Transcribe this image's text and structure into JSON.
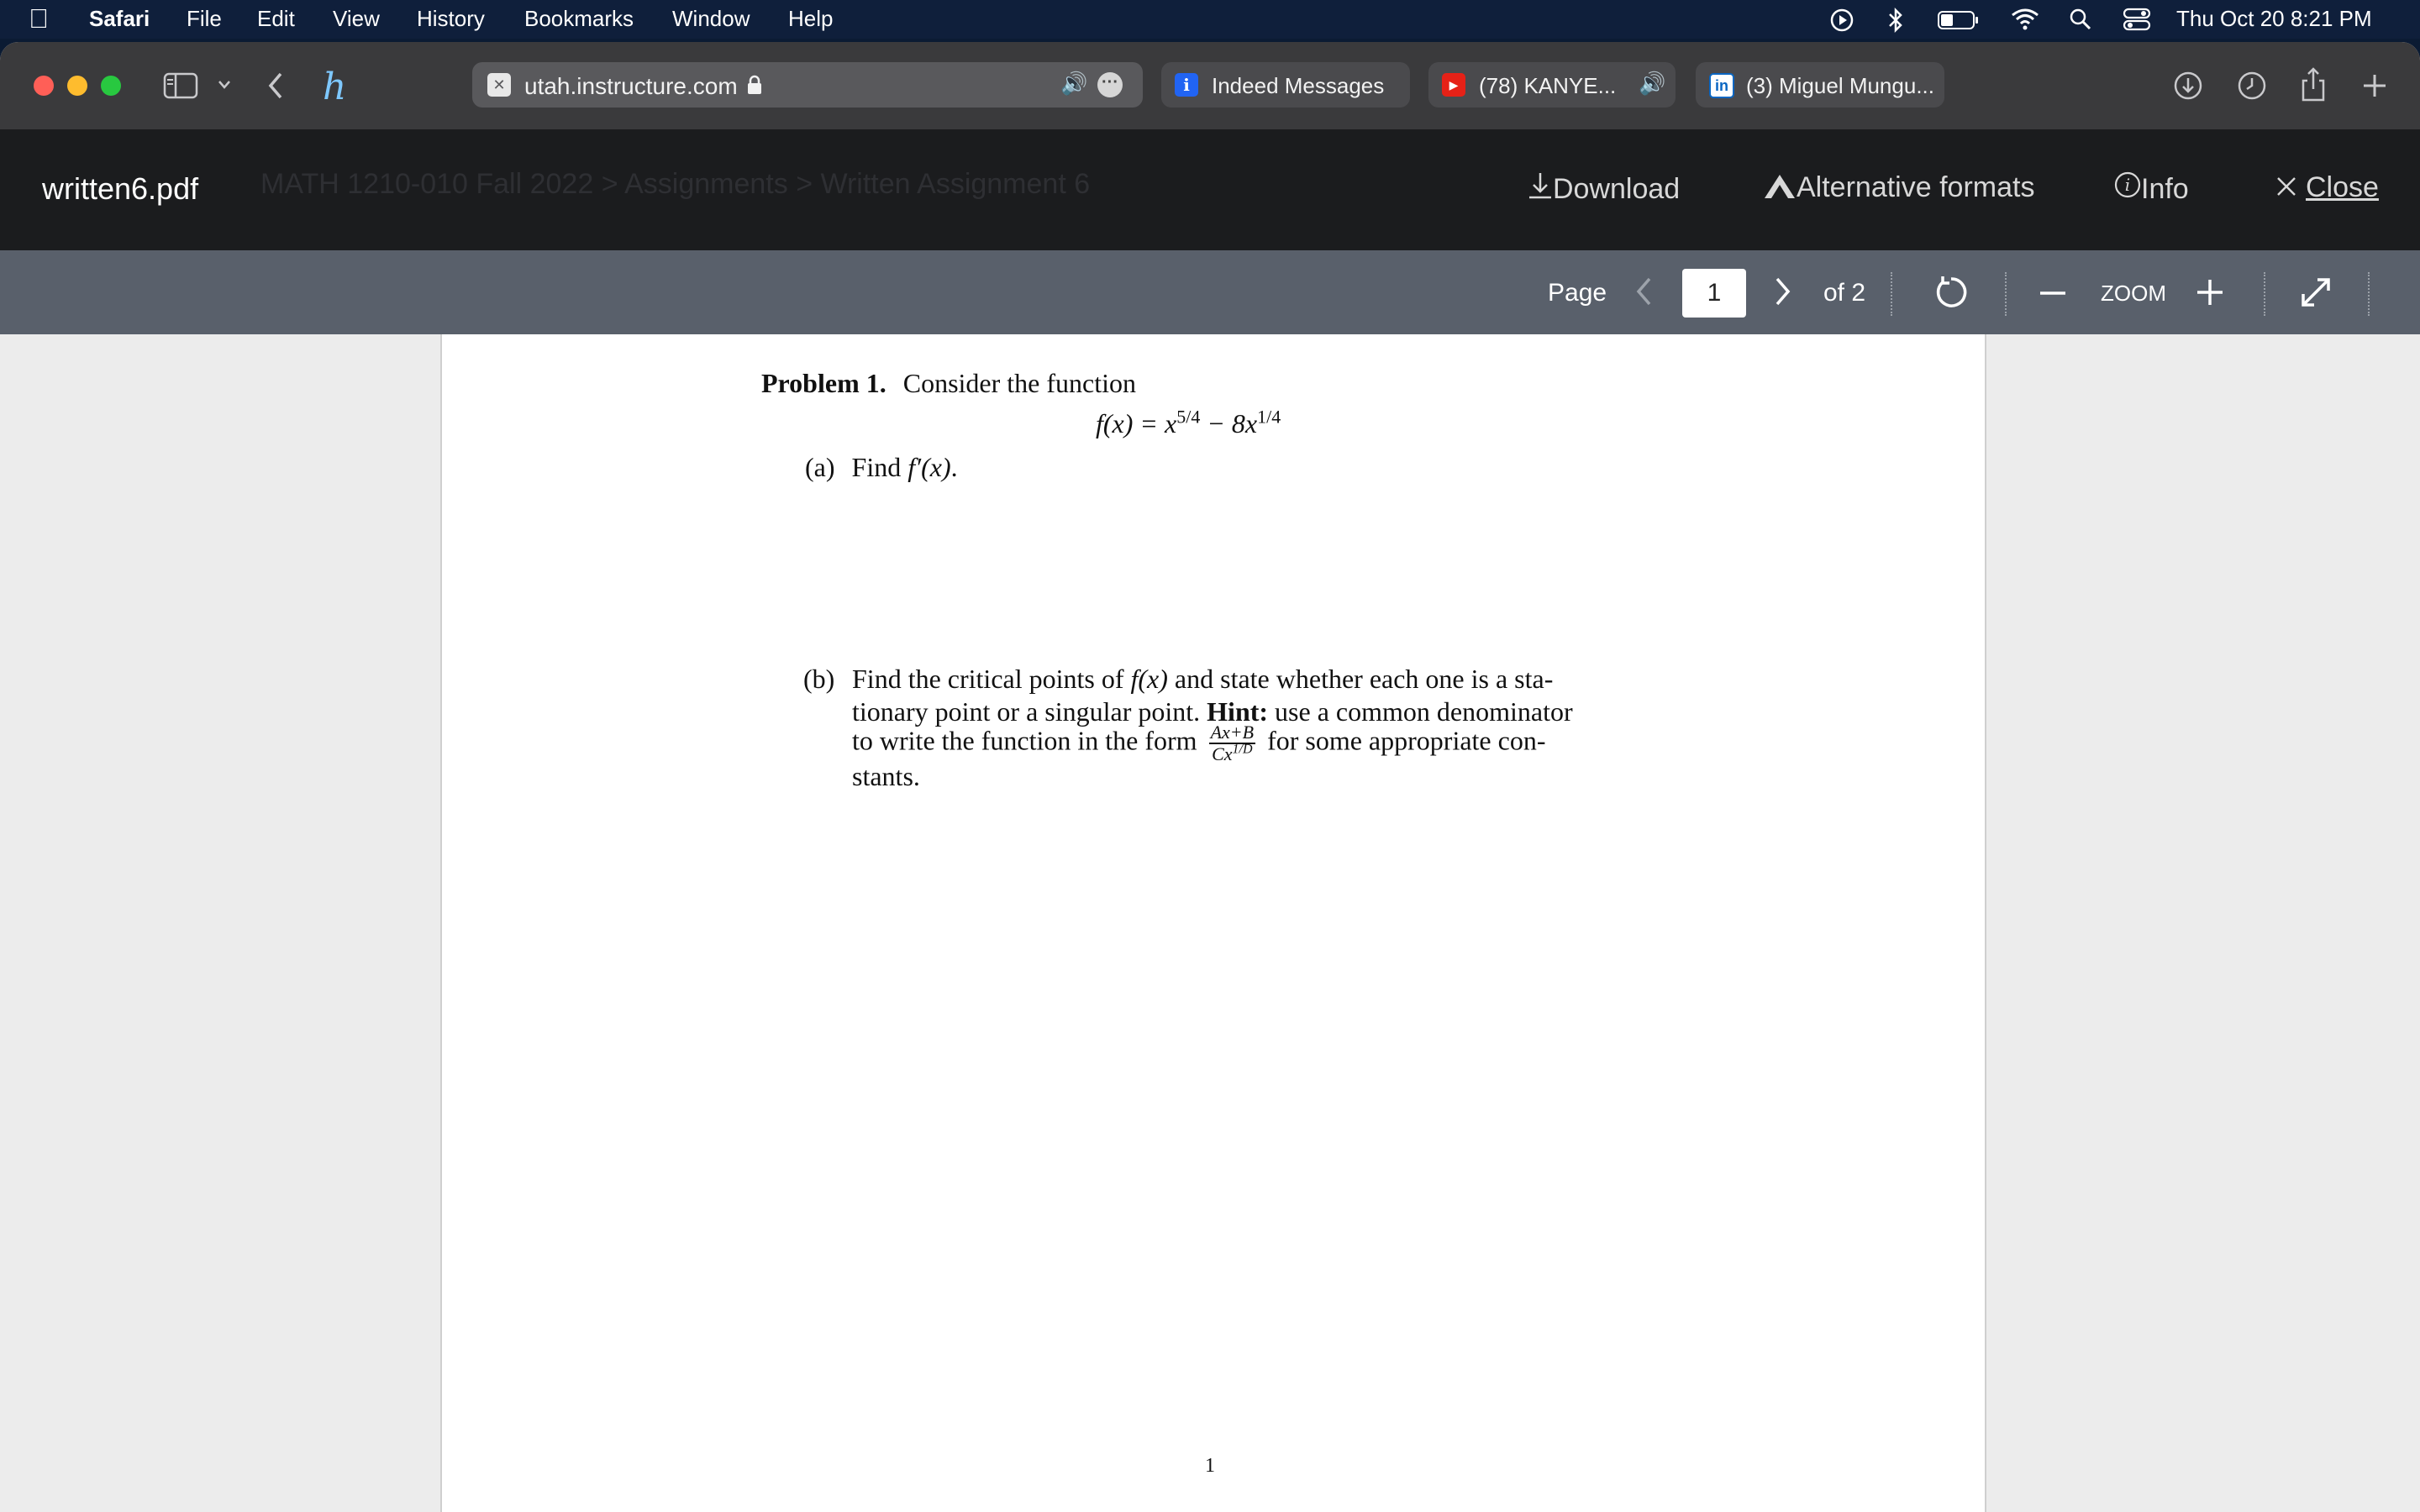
{
  "menubar": {
    "app": "Safari",
    "menus": [
      "File",
      "Edit",
      "View",
      "History",
      "Bookmarks",
      "Window",
      "Help"
    ],
    "clock": "Thu Oct 20  8:21 PM"
  },
  "browser": {
    "address": "utah.instructure.com",
    "tabs": [
      {
        "label": "Indeed Messages"
      },
      {
        "label": "(78) KANYE..."
      },
      {
        "label": "(3) Miguel Mungu..."
      }
    ]
  },
  "preview": {
    "filename": "written6.pdf",
    "breadcrumb": "MATH 1210-010 Fall 2022 > Assignments > Written Assignment 6",
    "actions": {
      "download": "Download",
      "alt_formats": "Alternative formats",
      "info": "Info",
      "close": "Close"
    }
  },
  "pdf_toolbar": {
    "page_label": "Page",
    "current_page": "1",
    "page_total": "of 2",
    "zoom_label": "ZOOM"
  },
  "document": {
    "problem_heading": "Problem 1.",
    "problem_intro": "Consider the function",
    "equation": {
      "lhs": "f(x) = x",
      "exp1": "5/4",
      "mid": " − 8x",
      "exp2": "1/4"
    },
    "part_a": {
      "label": "(a)",
      "text_pre": "Find ",
      "expr": "f′(x)",
      "text_post": "."
    },
    "part_b": {
      "label": "(b)",
      "line1_pre": "Find the critical points of ",
      "line1_expr": "f(x)",
      "line1_post": " and state whether each one is a sta-",
      "line2_pre": "tionary point or a singular point. ",
      "hint_label": "Hint:",
      "line2_post": " use a common denominator",
      "line3_pre": "to write the function in the form",
      "frac_num": "Ax+B",
      "frac_den": "Cx",
      "frac_den_exp": "1/D",
      "line3_post": "for some appropriate con-",
      "line4": "stants."
    },
    "page_number": "1"
  }
}
